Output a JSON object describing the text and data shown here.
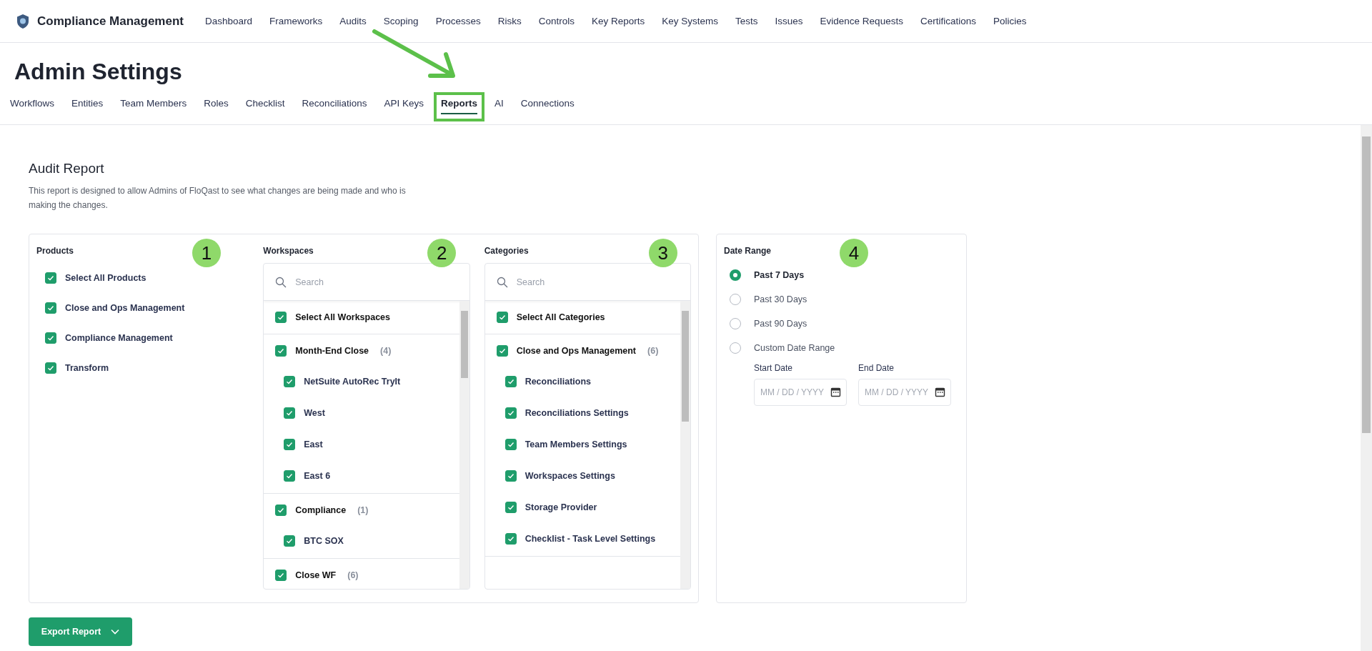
{
  "nav": {
    "brand": "Compliance Management",
    "items": [
      "Dashboard",
      "Frameworks",
      "Audits",
      "Scoping",
      "Processes",
      "Risks",
      "Controls",
      "Key Reports",
      "Key Systems",
      "Tests",
      "Issues",
      "Evidence Requests",
      "Certifications",
      "Policies"
    ]
  },
  "page_title": "Admin Settings",
  "tabs": [
    {
      "label": "Workflows",
      "selected": false,
      "highlighted": false
    },
    {
      "label": "Entities",
      "selected": false,
      "highlighted": false
    },
    {
      "label": "Team Members",
      "selected": false,
      "highlighted": false
    },
    {
      "label": "Roles",
      "selected": false,
      "highlighted": false
    },
    {
      "label": "Checklist",
      "selected": false,
      "highlighted": false
    },
    {
      "label": "Reconciliations",
      "selected": false,
      "highlighted": false
    },
    {
      "label": "API Keys",
      "selected": false,
      "highlighted": false
    },
    {
      "label": "Reports",
      "selected": true,
      "highlighted": true
    },
    {
      "label": "AI",
      "selected": false,
      "highlighted": false
    },
    {
      "label": "Connections",
      "selected": false,
      "highlighted": false
    }
  ],
  "report": {
    "title": "Audit Report",
    "description": "This report is designed to allow Admins of FloQast to see what changes are being made and who is making the changes."
  },
  "products": {
    "heading": "Products",
    "badge": "1",
    "items": [
      {
        "label": "Select All Products",
        "checked": true
      },
      {
        "label": "Close and Ops Management",
        "checked": true
      },
      {
        "label": "Compliance Management",
        "checked": true
      },
      {
        "label": "Transform",
        "checked": true
      }
    ]
  },
  "workspaces": {
    "heading": "Workspaces",
    "badge": "2",
    "search": {
      "placeholder": "Search"
    },
    "select_all": {
      "label": "Select All Workspaces",
      "checked": true
    },
    "groups": [
      {
        "label": "Month-End Close",
        "count": "(4)",
        "checked": true,
        "children": [
          {
            "label": "NetSuite AutoRec TryIt",
            "checked": true
          },
          {
            "label": "West",
            "checked": true
          },
          {
            "label": "East",
            "checked": true
          },
          {
            "label": "East 6",
            "checked": true
          }
        ]
      },
      {
        "label": "Compliance",
        "count": "(1)",
        "checked": true,
        "children": [
          {
            "label": "BTC SOX",
            "checked": true
          }
        ]
      },
      {
        "label": "Close WF",
        "count": "(6)",
        "checked": true
      }
    ]
  },
  "categories": {
    "heading": "Categories",
    "badge": "3",
    "search": {
      "placeholder": "Search"
    },
    "select_all": {
      "label": "Select All Categories",
      "checked": true
    },
    "groups": [
      {
        "label": "Close and Ops Management",
        "count": "(6)",
        "checked": true,
        "children": [
          {
            "label": "Reconciliations",
            "checked": true
          },
          {
            "label": "Reconciliations Settings",
            "checked": true
          },
          {
            "label": "Team Members Settings",
            "checked": true
          },
          {
            "label": "Workspaces Settings",
            "checked": true
          },
          {
            "label": "Storage Provider",
            "checked": true
          },
          {
            "label": "Checklist - Task Level Settings",
            "checked": true
          }
        ]
      }
    ]
  },
  "date_range": {
    "heading": "Date Range",
    "badge": "4",
    "options": [
      {
        "label": "Past 7 Days",
        "selected": true
      },
      {
        "label": "Past 30 Days",
        "selected": false
      },
      {
        "label": "Past 90 Days",
        "selected": false
      },
      {
        "label": "Custom Date Range",
        "selected": false
      }
    ],
    "fields": [
      {
        "label": "Start Date",
        "placeholder": "MM / DD / YYYY"
      },
      {
        "label": "End Date",
        "placeholder": "MM / DD / YYYY"
      }
    ]
  },
  "export_button": "Export Report"
}
